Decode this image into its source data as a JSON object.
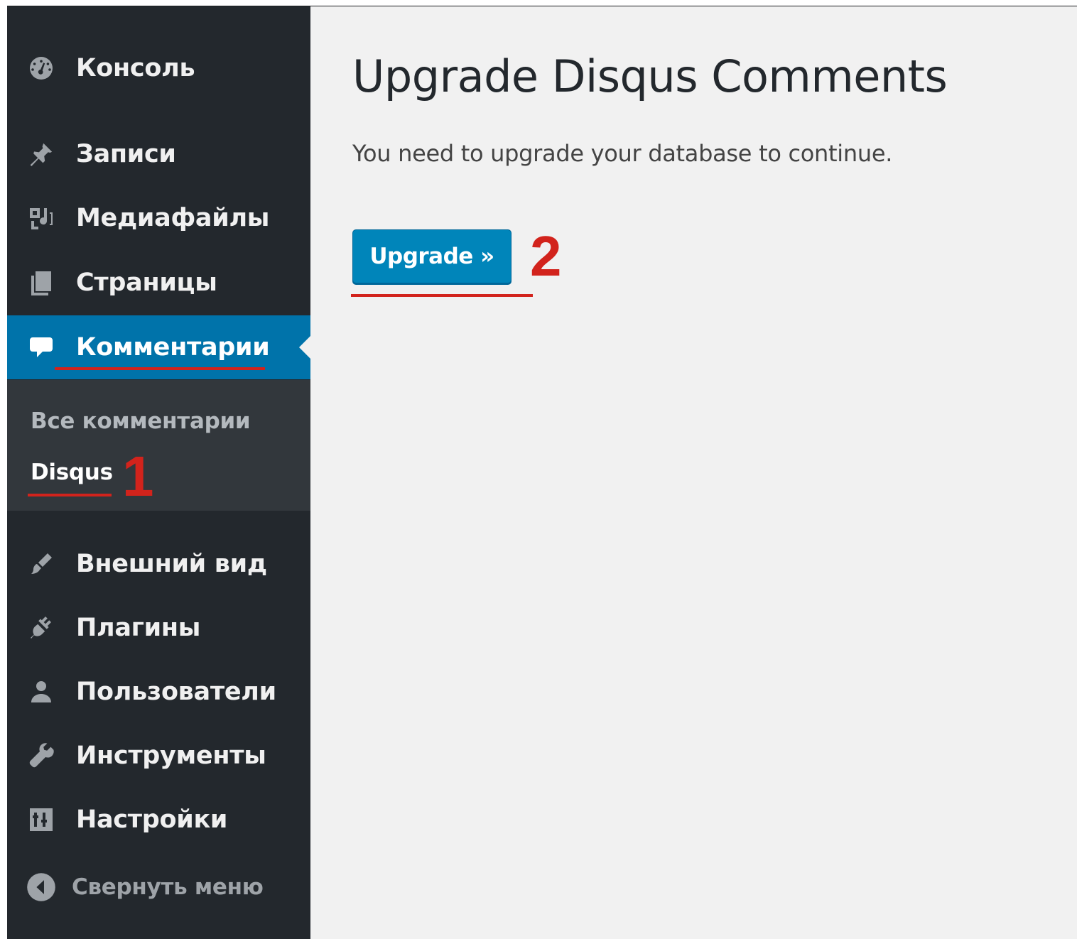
{
  "sidebar": {
    "items": [
      {
        "id": "dashboard",
        "label": "Консоль",
        "icon": "dashboard-icon"
      },
      {
        "id": "posts",
        "label": "Записи",
        "icon": "pin-icon"
      },
      {
        "id": "media",
        "label": "Медиафайлы",
        "icon": "media-icon"
      },
      {
        "id": "pages",
        "label": "Страницы",
        "icon": "pages-icon"
      },
      {
        "id": "comments",
        "label": "Комментарии",
        "icon": "comment-icon",
        "active": true
      },
      {
        "id": "appearance",
        "label": "Внешний вид",
        "icon": "brush-icon"
      },
      {
        "id": "plugins",
        "label": "Плагины",
        "icon": "plugin-icon"
      },
      {
        "id": "users",
        "label": "Пользователи",
        "icon": "user-icon"
      },
      {
        "id": "tools",
        "label": "Инструменты",
        "icon": "wrench-icon"
      },
      {
        "id": "settings",
        "label": "Настройки",
        "icon": "settings-icon"
      }
    ],
    "submenu": [
      {
        "label": "Все комментарии"
      },
      {
        "label": "Disqus",
        "current": true
      }
    ],
    "collapse_label": "Свернуть меню"
  },
  "main": {
    "title": "Upgrade Disqus Comments",
    "description": "You need to upgrade your database to continue.",
    "upgrade_button": "Upgrade »"
  },
  "annotations": {
    "step1": "1",
    "step2": "2"
  },
  "colors": {
    "sidebar_bg": "#23282d",
    "active_bg": "#0073aa",
    "submenu_bg": "#32373c",
    "content_bg": "#f1f1f1",
    "button_bg": "#0085ba",
    "annotation": "#d2231c"
  }
}
